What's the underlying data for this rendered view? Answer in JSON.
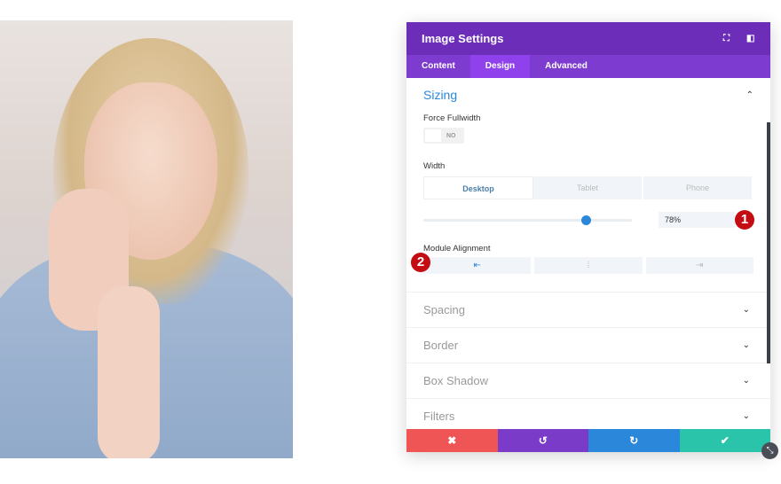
{
  "panel": {
    "title": "Image Settings",
    "icons": [
      "fullscreen-icon",
      "sidebar-icon"
    ],
    "tabs": [
      {
        "label": "Content"
      },
      {
        "label": "Design"
      },
      {
        "label": "Advanced"
      }
    ],
    "active_tab": "Design"
  },
  "sizing": {
    "title": "Sizing",
    "force_fullwidth_label": "Force Fullwidth",
    "toggle_value": "NO",
    "width_label": "Width",
    "devices": [
      "Desktop",
      "Tablet",
      "Phone"
    ],
    "active_device": "Desktop",
    "width_value": "78%",
    "width_percent": 78,
    "module_alignment_label": "Module Alignment",
    "alignment": [
      "left",
      "center",
      "right"
    ],
    "active_alignment": "left"
  },
  "badges": [
    "1",
    "2"
  ],
  "sections": [
    "Spacing",
    "Border",
    "Box Shadow",
    "Filters"
  ],
  "footer": {
    "buttons": [
      {
        "name": "cancel",
        "icon": "✖",
        "color": "#ef5555"
      },
      {
        "name": "undo",
        "icon": "↺",
        "color": "#7b3bc9"
      },
      {
        "name": "redo",
        "icon": "↻",
        "color": "#2b87da"
      },
      {
        "name": "save",
        "icon": "✔",
        "color": "#29c4a9"
      }
    ]
  },
  "colors": {
    "header": "#6c2eb9",
    "tabs": "#7e3bd0",
    "accent": "#2b87da",
    "badge": "#c40d13"
  }
}
